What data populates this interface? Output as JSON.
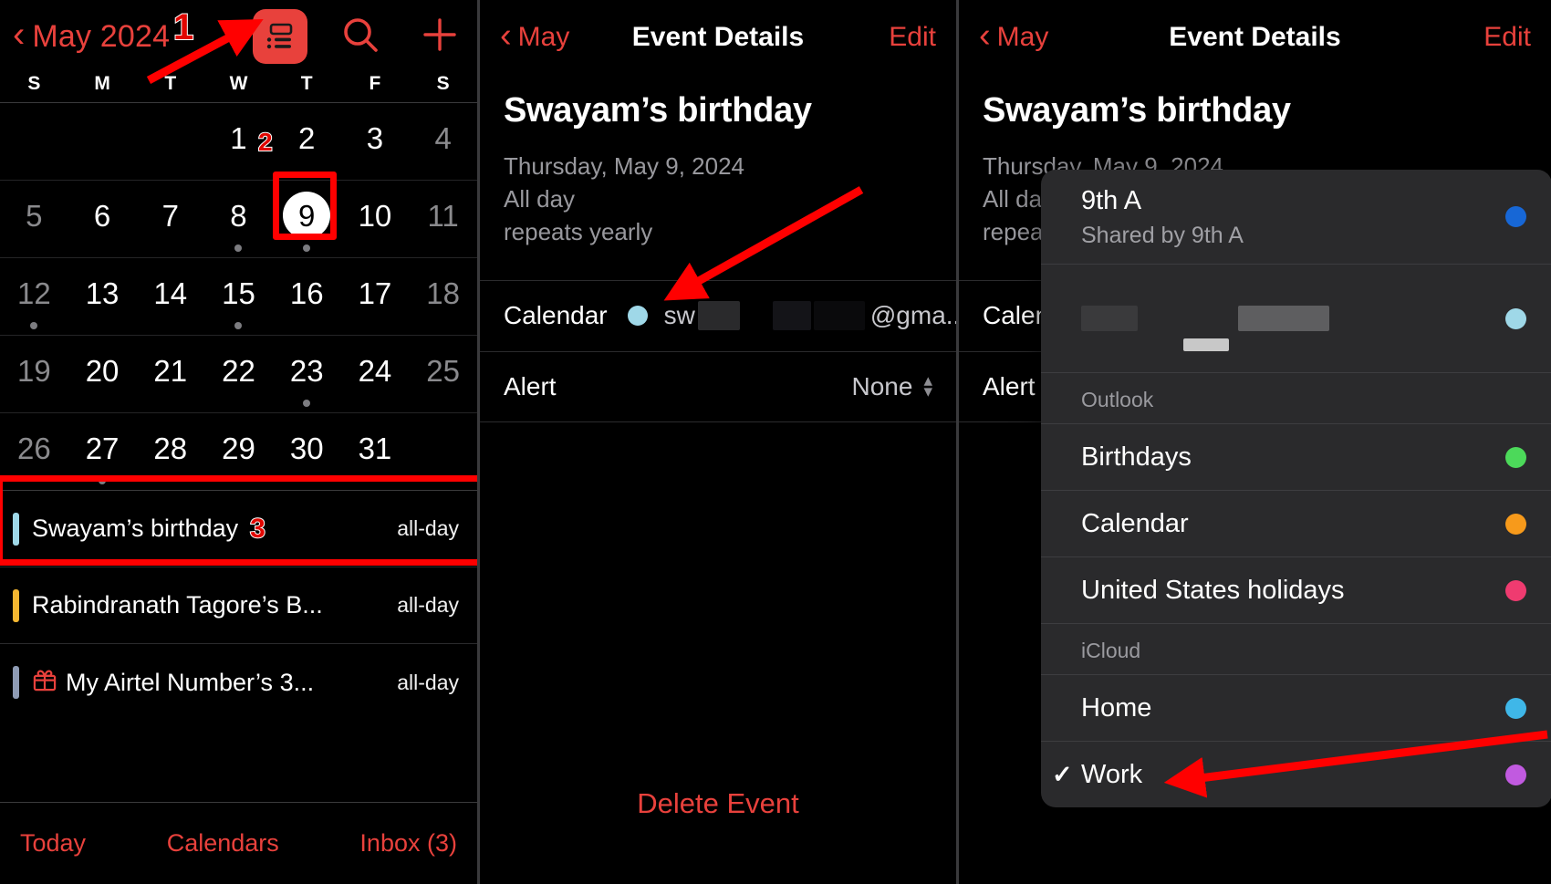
{
  "left_panel": {
    "header": {
      "back_icon": "chevron-left-icon",
      "month_title": "May 2024",
      "list_view_icon": "list-view-icon",
      "search_icon": "search-icon",
      "add_icon": "plus-icon"
    },
    "day_labels": [
      "S",
      "M",
      "T",
      "W",
      "T",
      "F",
      "S"
    ],
    "weeks": [
      [
        {
          "num": "",
          "weekend": true,
          "dot": false
        },
        {
          "num": "",
          "weekend": false,
          "dot": false
        },
        {
          "num": "",
          "weekend": false,
          "dot": false
        },
        {
          "num": "1",
          "weekend": false,
          "dot": false
        },
        {
          "num": "2",
          "weekend": false,
          "dot": false
        },
        {
          "num": "3",
          "weekend": false,
          "dot": false
        },
        {
          "num": "4",
          "weekend": true,
          "dot": false
        }
      ],
      [
        {
          "num": "5",
          "weekend": true,
          "dot": false
        },
        {
          "num": "6",
          "weekend": false,
          "dot": false
        },
        {
          "num": "7",
          "weekend": false,
          "dot": false
        },
        {
          "num": "8",
          "weekend": false,
          "dot": true
        },
        {
          "num": "9",
          "weekend": false,
          "dot": true,
          "today": true
        },
        {
          "num": "10",
          "weekend": false,
          "dot": false
        },
        {
          "num": "11",
          "weekend": true,
          "dot": false
        }
      ],
      [
        {
          "num": "12",
          "weekend": true,
          "dot": true
        },
        {
          "num": "13",
          "weekend": false,
          "dot": false
        },
        {
          "num": "14",
          "weekend": false,
          "dot": false
        },
        {
          "num": "15",
          "weekend": false,
          "dot": true
        },
        {
          "num": "16",
          "weekend": false,
          "dot": false
        },
        {
          "num": "17",
          "weekend": false,
          "dot": false
        },
        {
          "num": "18",
          "weekend": true,
          "dot": false
        }
      ],
      [
        {
          "num": "19",
          "weekend": true,
          "dot": false
        },
        {
          "num": "20",
          "weekend": false,
          "dot": false
        },
        {
          "num": "21",
          "weekend": false,
          "dot": false
        },
        {
          "num": "22",
          "weekend": false,
          "dot": false
        },
        {
          "num": "23",
          "weekend": false,
          "dot": true
        },
        {
          "num": "24",
          "weekend": false,
          "dot": false
        },
        {
          "num": "25",
          "weekend": true,
          "dot": false
        }
      ],
      [
        {
          "num": "26",
          "weekend": true,
          "dot": false
        },
        {
          "num": "27",
          "weekend": false,
          "dot": true
        },
        {
          "num": "28",
          "weekend": false,
          "dot": false
        },
        {
          "num": "29",
          "weekend": false,
          "dot": false
        },
        {
          "num": "30",
          "weekend": false,
          "dot": false
        },
        {
          "num": "31",
          "weekend": false,
          "dot": false
        },
        {
          "num": "",
          "weekend": true,
          "dot": false
        }
      ]
    ],
    "events": [
      {
        "title": "Swayam’s birthday",
        "duration": "all-day",
        "bar_color": "#9fd8e8",
        "gift": false
      },
      {
        "title": "Rabindranath Tagore’s B...",
        "duration": "all-day",
        "bar_color": "#f5b731",
        "gift": false
      },
      {
        "title": "My Airtel Number’s 3...",
        "duration": "all-day",
        "bar_color": "#8e9bb4",
        "gift": true
      }
    ],
    "bottom_bar": [
      "Today",
      "Calendars",
      "Inbox (3)"
    ]
  },
  "mid_panel": {
    "nav": {
      "back_label": "May",
      "title": "Event Details",
      "edit_label": "Edit"
    },
    "event": {
      "name": "Swayam’s birthday",
      "date": "Thursday, May 9, 2024",
      "all_day": "All day",
      "repeat": "repeats yearly"
    },
    "rows": [
      {
        "label": "Calendar",
        "dot_color": "#9fd8e8",
        "value_prefix": "sw",
        "value_suffix": "@gma...",
        "redacted": true,
        "control": "stepper"
      },
      {
        "label": "Alert",
        "value": "None",
        "control": "stepper"
      }
    ],
    "delete_label": "Delete Event"
  },
  "right_panel": {
    "nav": {
      "back_label": "May",
      "title": "Event Details",
      "edit_label": "Edit"
    },
    "event": {
      "name": "Swayam’s birthday",
      "date": "Thursday, May 9, 2024",
      "all_day": "All day",
      "repeat": "repeats yearly"
    },
    "rows": [
      {
        "label": "Calendar",
        "dot_color": "#9fd8e8"
      },
      {
        "label": "Alert"
      }
    ],
    "popup": {
      "header": {
        "title": "9th A",
        "subtitle": "Shared by 9th A",
        "dot_color": "#1767d6"
      },
      "items": [
        {
          "label": "",
          "redacted": true,
          "dot_color": "#9fd8e8",
          "checked": false
        },
        {
          "group": "Outlook"
        },
        {
          "label": "Birthdays",
          "dot_color": "#4cd95a",
          "checked": false
        },
        {
          "label": "Calendar",
          "dot_color": "#f79a1b",
          "checked": false
        },
        {
          "label": "United States holidays",
          "dot_color": "#ef3b70",
          "checked": false
        },
        {
          "group": "iCloud"
        },
        {
          "label": "Home",
          "dot_color": "#3fb7e8",
          "checked": false
        },
        {
          "label": "Work",
          "dot_color": "#c15ae0",
          "checked": true
        }
      ]
    }
  },
  "annotations": {
    "step1": "1",
    "step2": "2",
    "step3": "3",
    "accent_color": "#ff0000"
  }
}
